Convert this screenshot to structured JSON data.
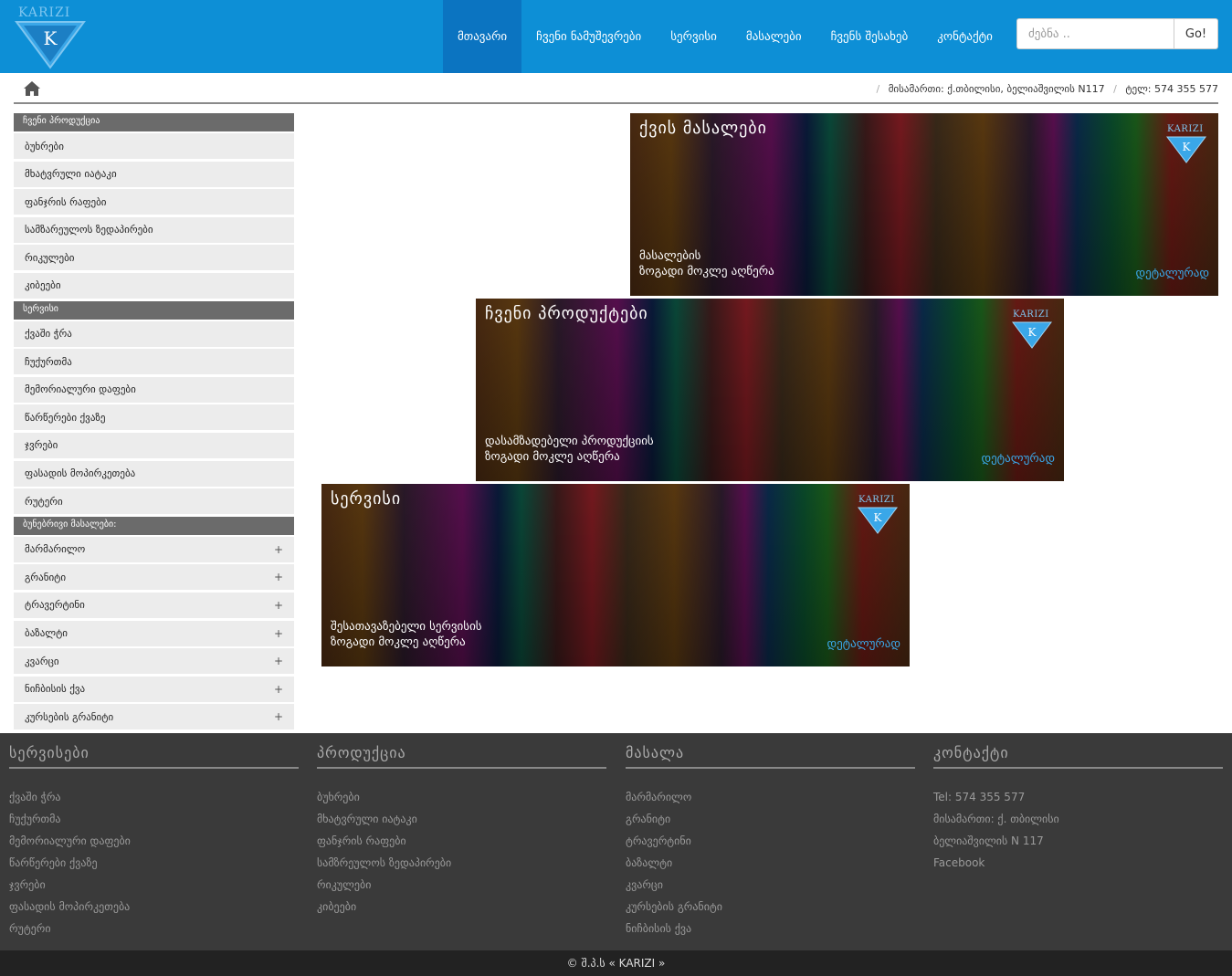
{
  "header": {
    "logo_text": "KARIZI",
    "nav": [
      {
        "label": "მთავარი",
        "active": true
      },
      {
        "label": "ჩვენი ნამუშევრები",
        "active": false
      },
      {
        "label": "სერვისი",
        "active": false
      },
      {
        "label": "მასალები",
        "active": false
      },
      {
        "label": "ჩვენს შესახებ",
        "active": false
      },
      {
        "label": "კონტაქტი",
        "active": false
      }
    ],
    "search_placeholder": "ძებნა ..",
    "search_button": "Go!"
  },
  "breadcrumb": {
    "address": "მისამართი: ქ.თბილისი, ბელიაშვილის N117",
    "phone": "ტელ: 574 355 577"
  },
  "sidebar": {
    "sections": [
      {
        "title": "ჩვენი პროდუქცია",
        "items": [
          "ბუხრები",
          "მხატვრული იატაკი",
          "ფანჯრის რაფები",
          "სამზარეულოს ზედაპირები",
          "რიკულები",
          "კიბეები"
        ],
        "expandable": false
      },
      {
        "title": "სერვისი",
        "items": [
          "ქვაში ჭრა",
          "ჩუქურთმა",
          "მემორიალური დაფები",
          "წარწერები ქვაზე",
          "ჯვრები",
          "ფასადის მოპირკეთება",
          "რუტერი"
        ],
        "expandable": false
      },
      {
        "title": "ბუნებრივი მასალები:",
        "items": [
          "მარმარილო",
          "გრანიტი",
          "ტრავერტინი",
          "ბაზალტი",
          "კვარცი",
          "ნიჩბისის ქვა",
          "კურსების გრანიტი"
        ],
        "expandable": true,
        "expand_symbol": "+"
      }
    ]
  },
  "banners": [
    {
      "title": "ქვის მასალები",
      "desc1": "მასალების",
      "desc2": "ზოგადი მოკლე აღწერა",
      "more": "დეტალურად",
      "logo_text": "KARIZI"
    },
    {
      "title": "ჩვენი პროდუქტები",
      "desc1": "დასამზადებელი პროდუქციის",
      "desc2": "ზოგადი მოკლე აღწერა",
      "more": "დეტალურად",
      "logo_text": "KARIZI"
    },
    {
      "title": "სერვისი",
      "desc1": "შესათავაზებელი სერვისის",
      "desc2": "ზოგადი მოკლე აღწერა",
      "more": "დეტალურად",
      "logo_text": "KARIZI"
    }
  ],
  "footer": {
    "columns": [
      {
        "title": "სერვისები",
        "items": [
          "ქვაში ჭრა",
          "ჩუქურთმა",
          "მემორიალური დაფები",
          "წარწერები ქვაზე",
          "ჯვრები",
          "ფასადის მოპირკეთება",
          "რუტერი"
        ]
      },
      {
        "title": "პროდუქცია",
        "items": [
          "ბუხრები",
          "მხატვრული იატაკი",
          "ფანჯრის რაფები",
          "სამზრეულოს ზედაპირები",
          "რიკულები",
          "კიბეები"
        ]
      },
      {
        "title": "მასალა",
        "items": [
          "მარმარილო",
          "გრანიტი",
          "ტრავერტინი",
          "ბაზალტი",
          "კვარცი",
          "კურსების გრანიტი",
          "ნიჩბისის ქვა"
        ]
      },
      {
        "title": "კონტაქტი",
        "items": [
          "Tel: 574 355 577",
          "მისამართი: ქ. თბილისი",
          "ბელიაშვილის N 117",
          "Facebook"
        ]
      }
    ],
    "copyright": "© შ.პ.ს « KARIZI »"
  },
  "colors": {
    "header_bg": "#0d8fd6",
    "nav_active_bg": "#0b74c1",
    "sidebar_head_bg": "#6b6b6b",
    "footer_bg": "#3a3a3a",
    "link_blue": "#3aa7e8"
  }
}
